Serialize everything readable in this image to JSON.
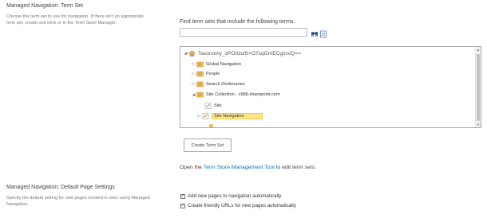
{
  "term_set_section": {
    "title": "Managed Navigation: Term Set",
    "description": "Choose the term set to use for navigation. If there isn't an appropriate term set, create one here or in the Term Store Manager."
  },
  "search": {
    "label": "Find term sets that include the following terms.",
    "value": "",
    "search_icon": "binoculars-icon",
    "browse_icon": "address-book-icon"
  },
  "tree": {
    "root": {
      "label": "Taxonomy_zPO0zulS+O7xqGmECgzvcQ==",
      "expanded": true,
      "icon": "globe-house-icon"
    },
    "items": [
      {
        "label": "Global Navigation",
        "expanded": false,
        "icon": "term-group-icon"
      },
      {
        "label": "People",
        "expanded": false,
        "icon": "term-group-icon"
      },
      {
        "label": "Search Dictionaries",
        "expanded": false,
        "icon": "term-group-icon"
      },
      {
        "label": "Site Collection - c986.sharepoint.com",
        "expanded": true,
        "icon": "term-group-icon"
      }
    ],
    "children": [
      {
        "label": "Site",
        "icon": "term-set-icon"
      },
      {
        "label": "Site Navigation",
        "icon": "term-set-icon",
        "selected": true
      }
    ]
  },
  "create_button": {
    "label": "Create Term Set"
  },
  "open_text": {
    "prefix": "Open the ",
    "link": "Term Store Management Tool",
    "suffix": " to edit term sets."
  },
  "default_section": {
    "title": "Managed Navigation: Default Page Settings",
    "description": "Specify the default setting for new pages created in sites using Managed Navigation."
  },
  "checkboxes": [
    {
      "label": "Add new pages to navigation automatically",
      "checked": true
    },
    {
      "label": "Create friendly URLs for new pages automatically",
      "checked": true
    }
  ],
  "colors": {
    "link": "#0072c6",
    "selection": "#fde68a"
  }
}
